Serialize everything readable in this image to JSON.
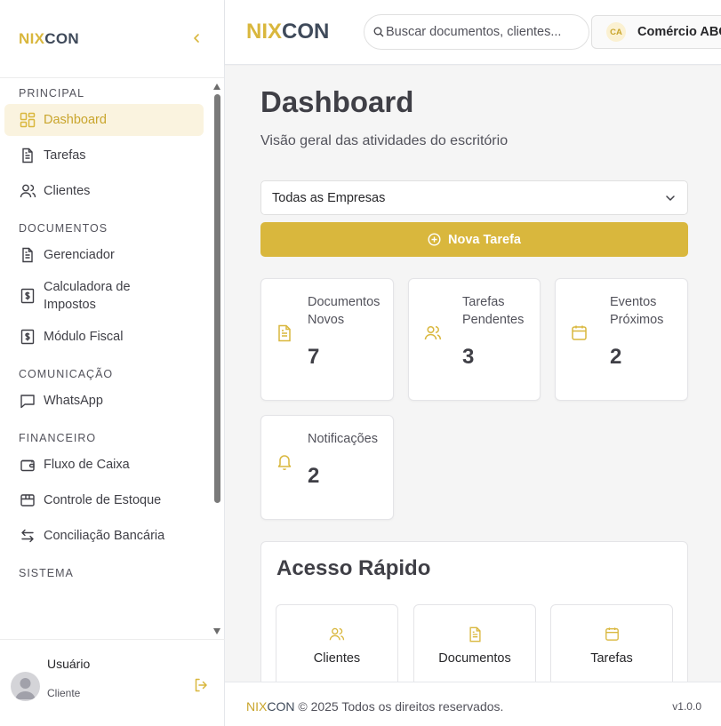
{
  "brand": {
    "part1": "NIX",
    "part2": "CON"
  },
  "colors": {
    "accent": "#d9b73d",
    "accent_light": "#faf3df",
    "logo_dark": "#3f4a5a"
  },
  "sidebar": {
    "sections": [
      {
        "title": "PRINCIPAL",
        "items": [
          {
            "label": "Dashboard",
            "icon": "dashboard-icon",
            "active": true
          },
          {
            "label": "Tarefas",
            "icon": "file-text-icon"
          },
          {
            "label": "Clientes",
            "icon": "users-icon"
          }
        ]
      },
      {
        "title": "DOCUMENTOS",
        "items": [
          {
            "label": "Gerenciador",
            "icon": "file-text-icon"
          },
          {
            "label": "Calculadora de Impostos",
            "icon": "dollar-icon"
          },
          {
            "label": "Módulo Fiscal",
            "icon": "dollar-icon"
          }
        ]
      },
      {
        "title": "COMUNICAÇÃO",
        "items": [
          {
            "label": "WhatsApp",
            "icon": "message-icon"
          }
        ]
      },
      {
        "title": "FINANCEIRO",
        "items": [
          {
            "label": "Fluxo de Caixa",
            "icon": "wallet-icon"
          },
          {
            "label": "Controle de Estoque",
            "icon": "box-icon"
          },
          {
            "label": "Conciliação Bancária",
            "icon": "arrows-exchange-icon"
          }
        ]
      },
      {
        "title": "SISTEMA",
        "items": []
      }
    ],
    "user": {
      "name": "Usuário",
      "role": "Cliente"
    }
  },
  "header": {
    "search_placeholder": "Buscar documentos, clientes...",
    "company_initials": "CA",
    "company_name": "Comércio ABC"
  },
  "main": {
    "title": "Dashboard",
    "subtitle": "Visão geral das atividades do escritório",
    "company_filter": "Todas as Empresas",
    "new_task_label": "Nova Tarefa",
    "stats": [
      {
        "label": "Documentos Novos",
        "value": "7",
        "icon": "document-icon"
      },
      {
        "label": "Tarefas Pendentes",
        "value": "3",
        "icon": "users-icon"
      },
      {
        "label": "Eventos Próximos",
        "value": "2",
        "icon": "calendar-icon"
      },
      {
        "label": "Notificações",
        "value": "2",
        "icon": "bell-icon"
      }
    ],
    "quick_access": {
      "title": "Acesso Rápido",
      "items": [
        {
          "label": "Clientes",
          "icon": "users-icon"
        },
        {
          "label": "Documentos",
          "icon": "document-icon"
        },
        {
          "label": "Tarefas",
          "icon": "calendar-icon"
        }
      ]
    }
  },
  "footer": {
    "text": "© 2025 Todos os direitos reservados.",
    "version": "v1.0.0"
  }
}
